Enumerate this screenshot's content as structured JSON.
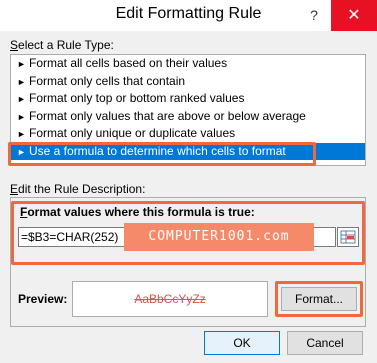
{
  "window": {
    "title": "Edit Formatting Rule",
    "help_label": "?",
    "close_label": "✕"
  },
  "rule_type": {
    "label_prefix": "S",
    "label_rest": "elect a Rule Type:",
    "items": [
      {
        "label": "Format all cells based on their values"
      },
      {
        "label": "Format only cells that contain"
      },
      {
        "label": "Format only top or bottom ranked values"
      },
      {
        "label": "Format only values that are above or below average"
      },
      {
        "label": "Format only unique or duplicate values"
      },
      {
        "label": "Use a formula to determine which cells to format"
      }
    ],
    "selected_index": 5
  },
  "description": {
    "label_prefix": "E",
    "label_rest": "dit the Rule Description:",
    "formula_label_prefix": "F",
    "formula_label_rest": "ormat values where this formula is true:",
    "formula_value": "=$B3=CHAR(252)",
    "watermark": "COMPUTER1001.com"
  },
  "preview": {
    "label": "Preview:",
    "sample_text": "AaBbCcYyZz",
    "sample_color": "#d9534f",
    "format_button": "Format..."
  },
  "buttons": {
    "ok": "OK",
    "cancel": "Cancel"
  },
  "colors": {
    "accent": "#0078d7",
    "highlight": "#f0683f",
    "close": "#e81123"
  }
}
